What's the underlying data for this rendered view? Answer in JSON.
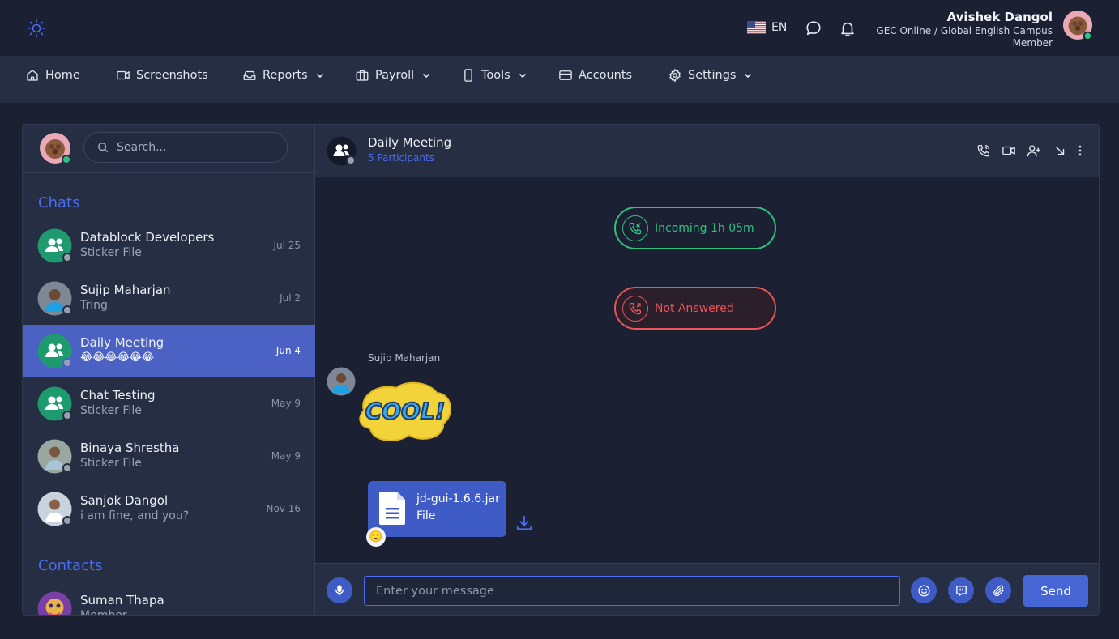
{
  "header": {
    "language": "EN",
    "user": {
      "name": "Avishek Dangol",
      "org": "GEC Online / Global English Campus",
      "role": "Member"
    }
  },
  "nav": {
    "items": [
      {
        "label": "Home"
      },
      {
        "label": "Screenshots"
      },
      {
        "label": "Reports"
      },
      {
        "label": "Payroll"
      },
      {
        "label": "Tools"
      },
      {
        "label": "Accounts"
      },
      {
        "label": "Settings"
      }
    ]
  },
  "sidebar": {
    "search_placeholder": "Search...",
    "chats_title": "Chats",
    "contacts_title": "Contacts",
    "chats": [
      {
        "name": "Datablock Developers",
        "last": " Sticker File",
        "date": "Jul 25"
      },
      {
        "name": "Sujip Maharjan",
        "last": "Tring",
        "date": "Jul 2"
      },
      {
        "name": "Daily Meeting",
        "last": "😂😂😂😂😂😂",
        "date": "Jun 4"
      },
      {
        "name": "Chat Testing",
        "last": " Sticker File",
        "date": "May 9"
      },
      {
        "name": "Binaya Shrestha",
        "last": " Sticker File",
        "date": "May 9"
      },
      {
        "name": "Sanjok Dangol",
        "last": "i am fine, and you?",
        "date": "Nov 16"
      }
    ],
    "contacts": [
      {
        "name": "Suman Thapa",
        "role": "Member"
      }
    ]
  },
  "conversation": {
    "title": "Daily Meeting",
    "subtitle": "5 Participants",
    "calls": [
      {
        "label": "Incoming 1h 05m",
        "status": "answered"
      },
      {
        "label": "Not Answered",
        "status": "missed"
      }
    ],
    "sender": "Sujip Maharjan",
    "sticker_text": "COOL!",
    "file": {
      "name": "jd-gui-1.6.6.jar",
      "type": "File"
    },
    "reaction": "🙁",
    "composer_placeholder": "Enter your message",
    "send_label": "Send"
  },
  "colors": {
    "accent": "#4a6cf0",
    "group_avatar": "#1e9b6e",
    "online": "#2ec27e",
    "offline": "#9aa0ae",
    "missed": "#e8555a"
  }
}
